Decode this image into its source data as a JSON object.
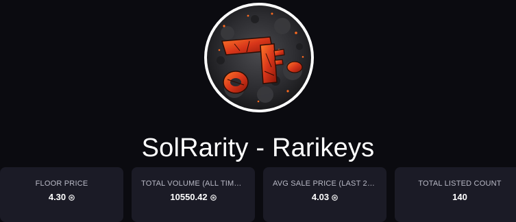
{
  "collection": {
    "title": "SolRarity - Rarikeys",
    "avatar_icon": "molten-lava-rock-key-logo"
  },
  "stats": [
    {
      "label": "FLOOR PRICE",
      "value": "4.30",
      "icon": "sol-coin-icon"
    },
    {
      "label": "TOTAL VOLUME (ALL TIME...",
      "value": "10550.42",
      "icon": "sol-coin-icon"
    },
    {
      "label": "AVG SALE PRICE (LAST 24...",
      "value": "4.03",
      "icon": "sol-coin-icon"
    },
    {
      "label": "TOTAL LISTED COUNT",
      "value": "140"
    }
  ],
  "colors": {
    "background": "#0b0b10",
    "card": "#1b1b26",
    "label": "#b9bac6",
    "lava": "#e2401c"
  }
}
